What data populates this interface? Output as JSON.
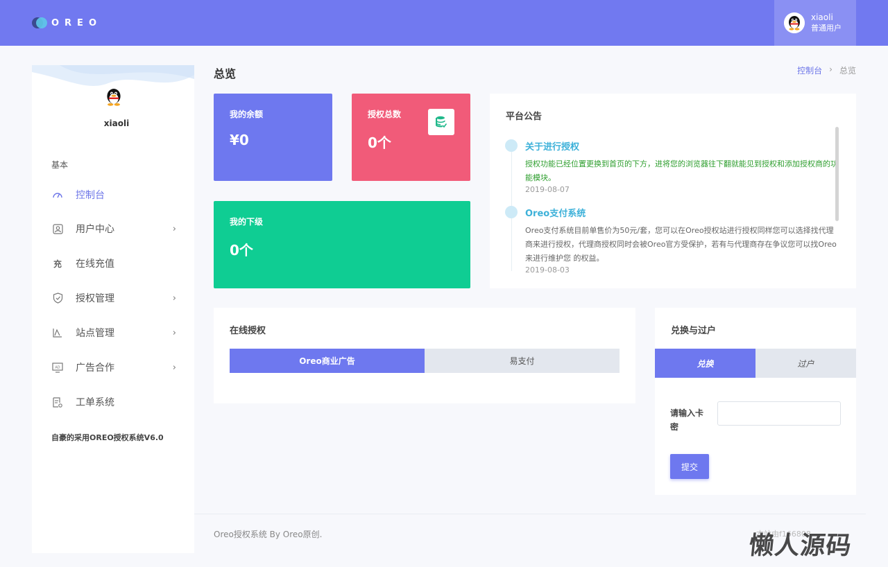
{
  "header": {
    "logo_text": "OREO",
    "user_name": "xiaoli",
    "user_role": "普通用户"
  },
  "sidebar": {
    "user_name": "xiaoli",
    "section_label": "基本",
    "items": [
      {
        "label": "控制台",
        "icon": "gauge-icon",
        "active": true,
        "has_children": false
      },
      {
        "label": "用户中心",
        "icon": "user-card-icon",
        "active": false,
        "has_children": true
      },
      {
        "label": "在线充值",
        "icon": "recharge-icon",
        "active": false,
        "has_children": false
      },
      {
        "label": "授权管理",
        "icon": "shield-icon",
        "active": false,
        "has_children": true
      },
      {
        "label": "站点管理",
        "icon": "chart-icon",
        "active": false,
        "has_children": true
      },
      {
        "label": "广告合作",
        "icon": "ad-icon",
        "active": false,
        "has_children": true
      },
      {
        "label": "工单系统",
        "icon": "ticket-icon",
        "active": false,
        "has_children": false
      }
    ],
    "footer": "自豪的采用OREO授权系统V6.0",
    "chevron": "›"
  },
  "page": {
    "title": "总览",
    "breadcrumb": {
      "home": "控制台",
      "separator": "›",
      "current": "总览"
    }
  },
  "stats": {
    "balance": {
      "title": "我的余额",
      "value": "¥0"
    },
    "auth_total": {
      "title": "授权总数",
      "value": "0个"
    },
    "subordinates": {
      "title": "我的下级",
      "value": "0个"
    }
  },
  "notice": {
    "title": "平台公告",
    "items": [
      {
        "heading": "关于进行授权",
        "body": "授权功能已经位置更换到首页的下方，进将您的浏览器往下翻就能见到授权和添加授权商的功能模块。",
        "date": "2019-08-07"
      },
      {
        "heading": "Oreo支付系统",
        "body": "Oreo支付系统目前单售价为50元/套，您可以在Oreo授权站进行授权同样您可以选择找代理商来进行授权，代理商授权同时会被Oreo官方受保护，若有与代理商存在争议您可以找Oreo来进行维护您 的权益。",
        "date": "2019-08-03"
      }
    ]
  },
  "online_auth": {
    "title": "在线授权",
    "tabs": [
      {
        "label": "Oreo商业广告",
        "active": true
      },
      {
        "label": "易支付",
        "active": false
      }
    ]
  },
  "exchange": {
    "title": "兑换与过户",
    "tabs": [
      {
        "label": "兑换",
        "active": true
      },
      {
        "label": "过户",
        "active": false
      }
    ],
    "field_label": "请输入卡密",
    "field_value": "",
    "submit_label": "提交"
  },
  "footer": {
    "copyright": "Oreo授权系统 By Oreo原创.",
    "right_text": "本站由f166808",
    "watermark": "懒人源码"
  },
  "colors": {
    "primary": "#6e78ef",
    "topbar": "#7179f0",
    "pink": "#f15b79",
    "green": "#0fcd93",
    "notice_link": "#3db1d9"
  }
}
